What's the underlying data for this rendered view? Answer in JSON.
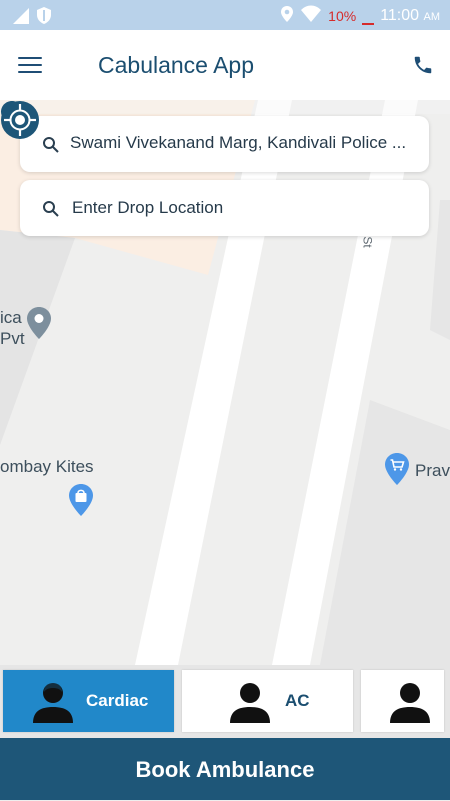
{
  "status_bar": {
    "battery_percent": "10%",
    "time": "11:00",
    "time_suffix": "AM",
    "icons": [
      "signal-icon",
      "shield-icon",
      "location-icon",
      "wifi-icon",
      "battery-icon"
    ]
  },
  "app_bar": {
    "title": "Cabulance App",
    "menu_icon": "hamburger-menu-icon",
    "call_icon": "phone-icon"
  },
  "search": {
    "pickup_value": "Swami Vivekanand Marg, Kandivali Police ...",
    "drop_placeholder": "Enter Drop Location"
  },
  "map": {
    "labels": {
      "ica_line1": "ica",
      "ica_line2": "Pvt",
      "kites": "ombay Kites",
      "prav": "Prav",
      "road": "St"
    },
    "colors": {
      "road": "#ffffff",
      "land": "#efefee",
      "beige": "#fbeee3",
      "pin": "#1e5678",
      "poi_grey": "#7d8f9d",
      "poi_blue": "#4d97e8"
    }
  },
  "categories": [
    {
      "label": "Cardiac",
      "active": true
    },
    {
      "label": "AC",
      "active": false
    },
    {
      "label": "",
      "active": false
    }
  ],
  "book_button": {
    "label": "Book Ambulance"
  },
  "colors": {
    "status_bar": "#b9d2ea",
    "accent": "#2188c9",
    "primary_dark": "#1e5678",
    "title_text": "#1b4e70"
  }
}
